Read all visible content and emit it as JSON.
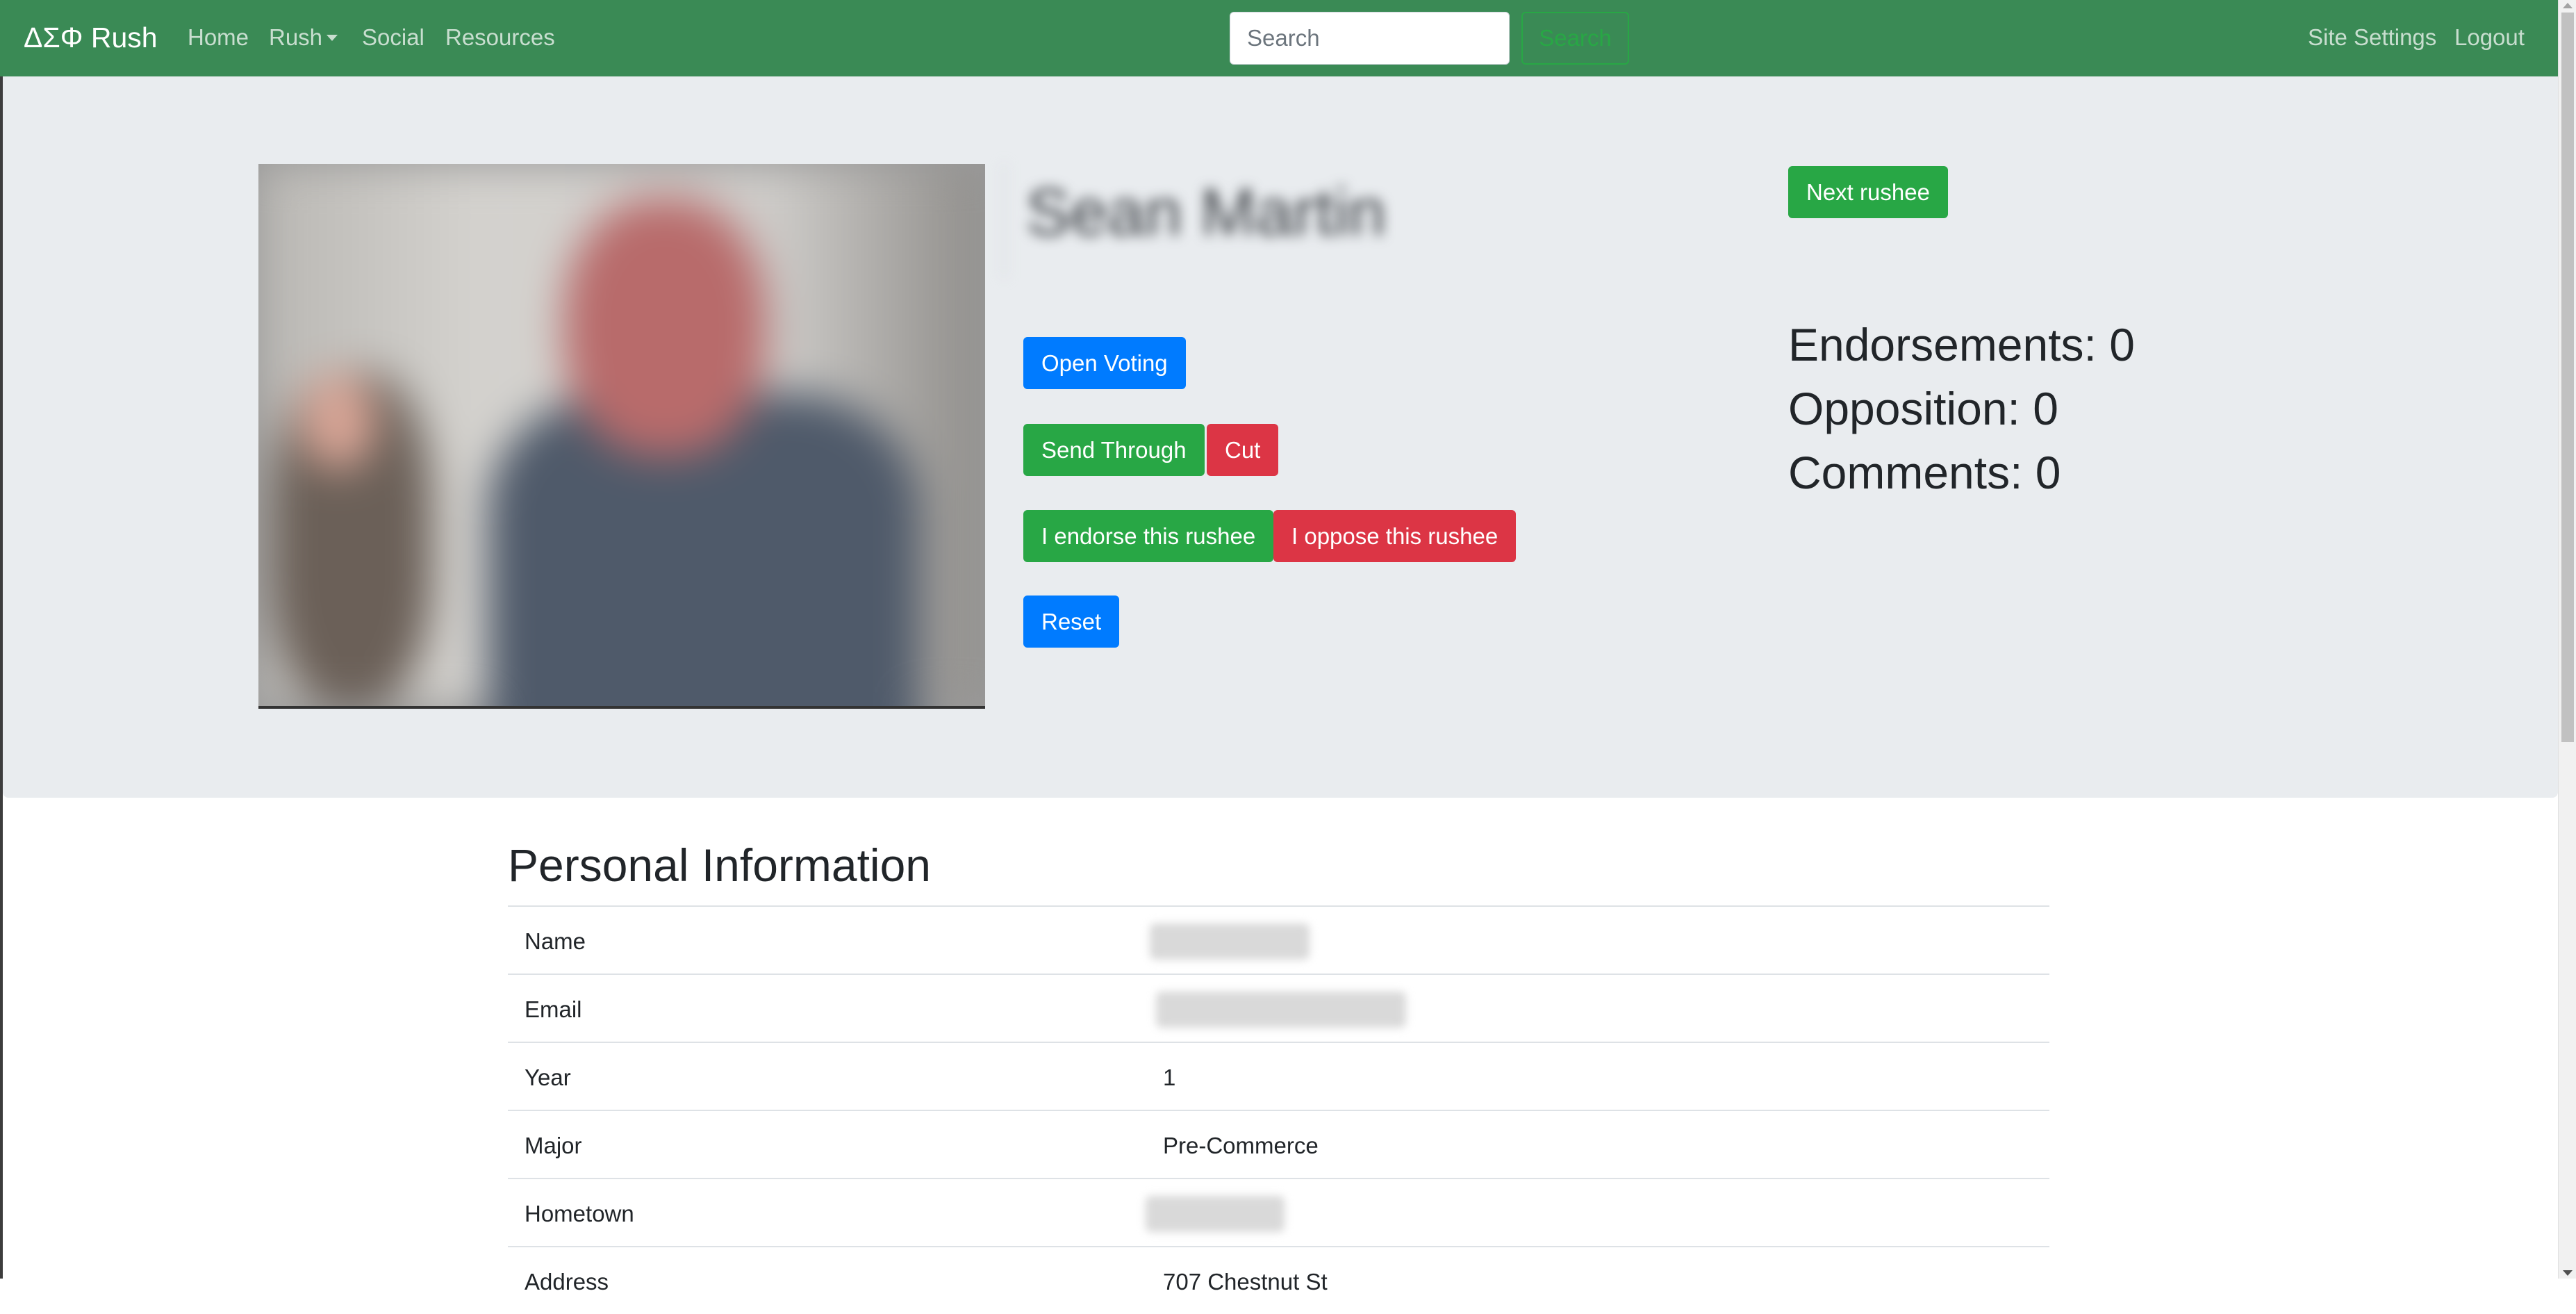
{
  "navbar": {
    "brand": "ΔΣΦ Rush",
    "links": {
      "home": "Home",
      "rush": "Rush",
      "social": "Social",
      "resources": "Resources",
      "site_settings": "Site Settings",
      "logout": "Logout"
    },
    "search": {
      "placeholder": "Search",
      "button_label": "Search"
    },
    "colors": {
      "background": "#3a8a55"
    }
  },
  "rushee": {
    "name": "Sean Martin",
    "buttons": {
      "next": "Next rushee",
      "open_voting": "Open Voting",
      "send_through": "Send Through",
      "cut": "Cut",
      "endorse": "I endorse this rushee",
      "oppose": "I oppose this rushee",
      "reset": "Reset"
    },
    "stats": {
      "endorsements": "Endorsements: 0",
      "opposition": "Opposition: 0",
      "comments": "Comments: 0"
    }
  },
  "personal_info": {
    "title": "Personal Information",
    "rows": [
      {
        "label": "Name",
        "value": ""
      },
      {
        "label": "Email",
        "value": ""
      },
      {
        "label": "Year",
        "value": "1"
      },
      {
        "label": "Major",
        "value": "Pre-Commerce"
      },
      {
        "label": "Hometown",
        "value": ""
      },
      {
        "label": "Address",
        "value": "707 Chestnut St"
      }
    ]
  },
  "colors": {
    "primary": "#007bff",
    "success": "#28a745",
    "danger": "#dc3545",
    "jumbotron": "#e9ecef"
  }
}
